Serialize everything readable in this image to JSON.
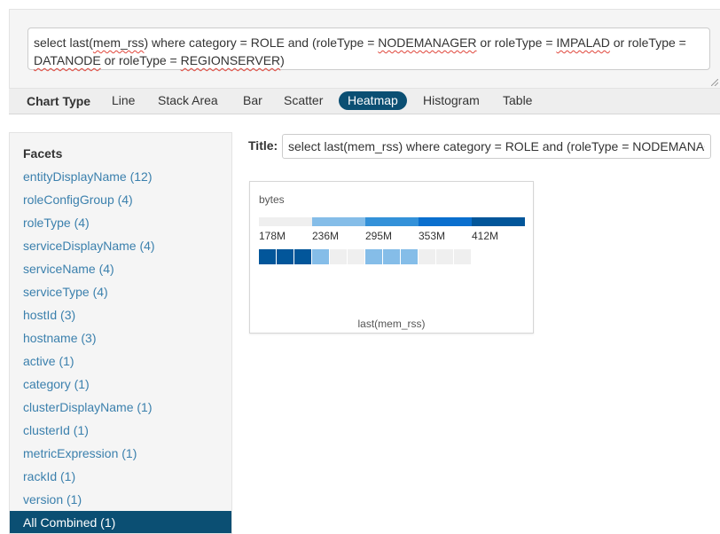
{
  "query": {
    "parts": [
      {
        "t": "select last("
      },
      {
        "t": "mem_rss",
        "spell": true
      },
      {
        "t": ") where category = ROLE and (roleType = "
      },
      {
        "t": "NODEMANAGER",
        "spell": true
      },
      {
        "t": " or roleType = "
      },
      {
        "t": "IMPALAD",
        "spell": true
      },
      {
        "t": " or roleType = "
      },
      {
        "t": "DATANODE",
        "spell": true
      },
      {
        "t": " or roleType = "
      },
      {
        "t": "REGIONSERVER",
        "spell": true
      },
      {
        "t": ")"
      }
    ]
  },
  "chart_type": {
    "label": "Chart Type",
    "tabs": [
      {
        "label": "Line",
        "active": false
      },
      {
        "label": "Stack Area",
        "active": false
      },
      {
        "label": "Bar",
        "active": false
      },
      {
        "label": "Scatter",
        "active": false
      },
      {
        "label": "Heatmap",
        "active": true
      },
      {
        "label": "Histogram",
        "active": false
      },
      {
        "label": "Table",
        "active": false
      }
    ]
  },
  "facets": {
    "title": "Facets",
    "items": [
      "entityDisplayName (12)",
      "roleConfigGroup (4)",
      "roleType (4)",
      "serviceDisplayName (4)",
      "serviceName (4)",
      "serviceType (4)",
      "hostId (3)",
      "hostname (3)",
      "active (1)",
      "category (1)",
      "clusterDisplayName (1)",
      "clusterId (1)",
      "metricExpression (1)",
      "rackId (1)",
      "version (1)"
    ],
    "selected": "All Combined (1)"
  },
  "chart_title": {
    "label": "Title:",
    "value": "select last(mem_rss) where category = ROLE and (roleType = NODEMANAGER or roleType = IMPALAD or roleType = DATANODE or roleType = REGIONSERVER)"
  },
  "colors": {
    "bin_colors": [
      "#efefef",
      "#85bde8",
      "#3391d9",
      "#0a6fce",
      "#02569a"
    ]
  },
  "chart_data": {
    "type": "heatmap",
    "unit_label": "bytes",
    "x_label": "last(mem_rss)",
    "legend_ticks": [
      "178M",
      "236M",
      "295M",
      "353M",
      "412M"
    ],
    "cells": [
      4,
      4,
      4,
      1,
      0,
      0,
      1,
      1,
      1,
      0,
      0,
      0
    ]
  }
}
